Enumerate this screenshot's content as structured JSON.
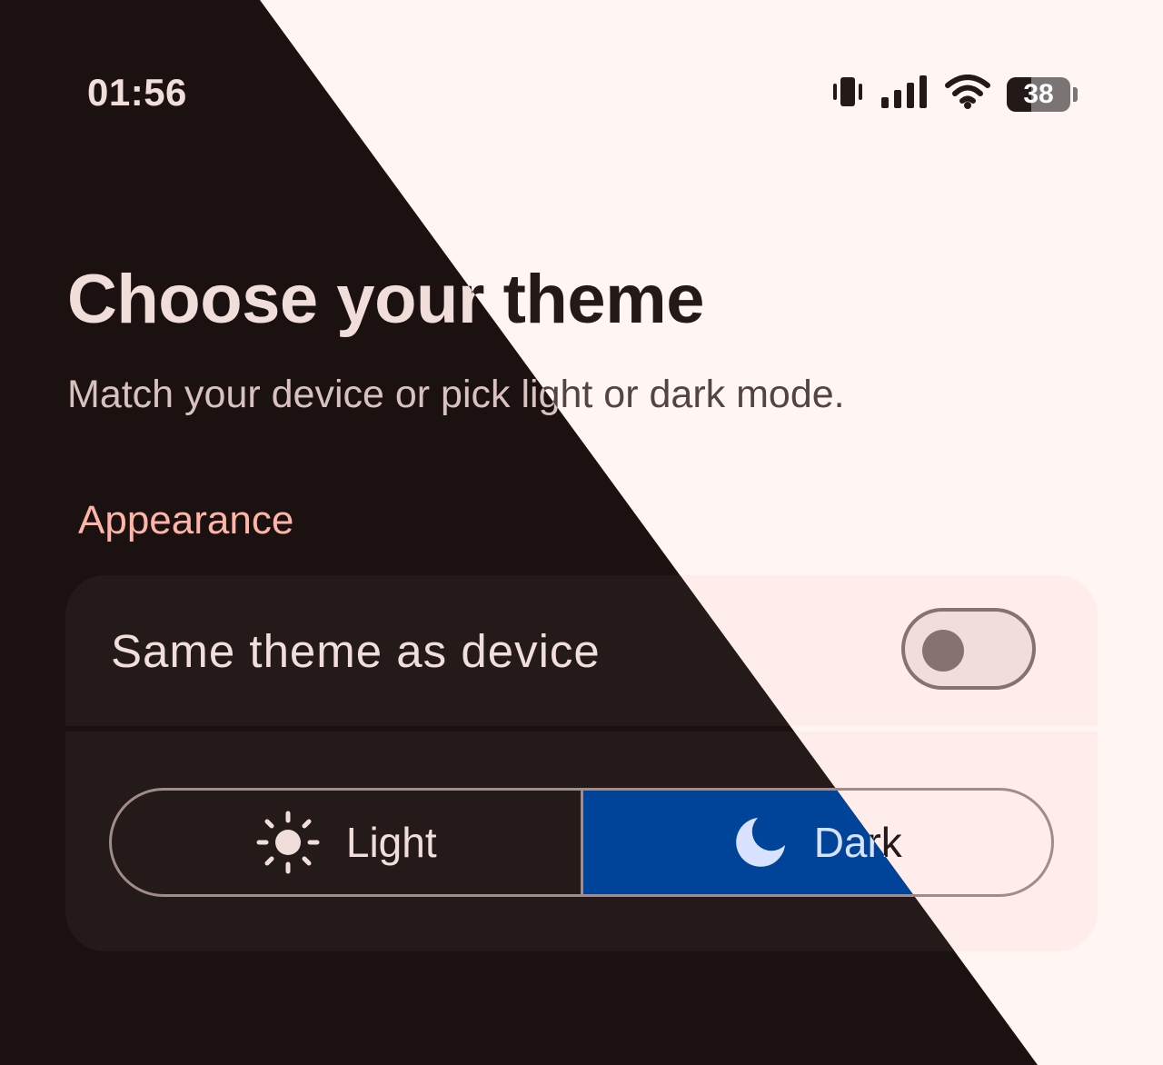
{
  "status_bar": {
    "time": "01:56",
    "battery_level": "38",
    "icons": [
      "vibrate-icon",
      "signal-icon",
      "wifi-icon",
      "battery-icon"
    ]
  },
  "page": {
    "title": "Choose your theme",
    "subtitle": "Match your device or pick light or dark mode."
  },
  "appearance": {
    "section_label": "Appearance",
    "same_as_device": {
      "label": "Same theme as device",
      "enabled": false
    },
    "segmented": {
      "options": [
        {
          "label": "Light",
          "icon": "sun-icon",
          "selected": false
        },
        {
          "label": "Dark",
          "icon": "moon-icon",
          "selected": true
        }
      ]
    }
  },
  "colors": {
    "dark_background": "#1b1110",
    "light_background": "#fff6f4",
    "accent_dark": "#ffb4a8",
    "accent_light": "#904a42",
    "selected_segment": "#00449a"
  }
}
